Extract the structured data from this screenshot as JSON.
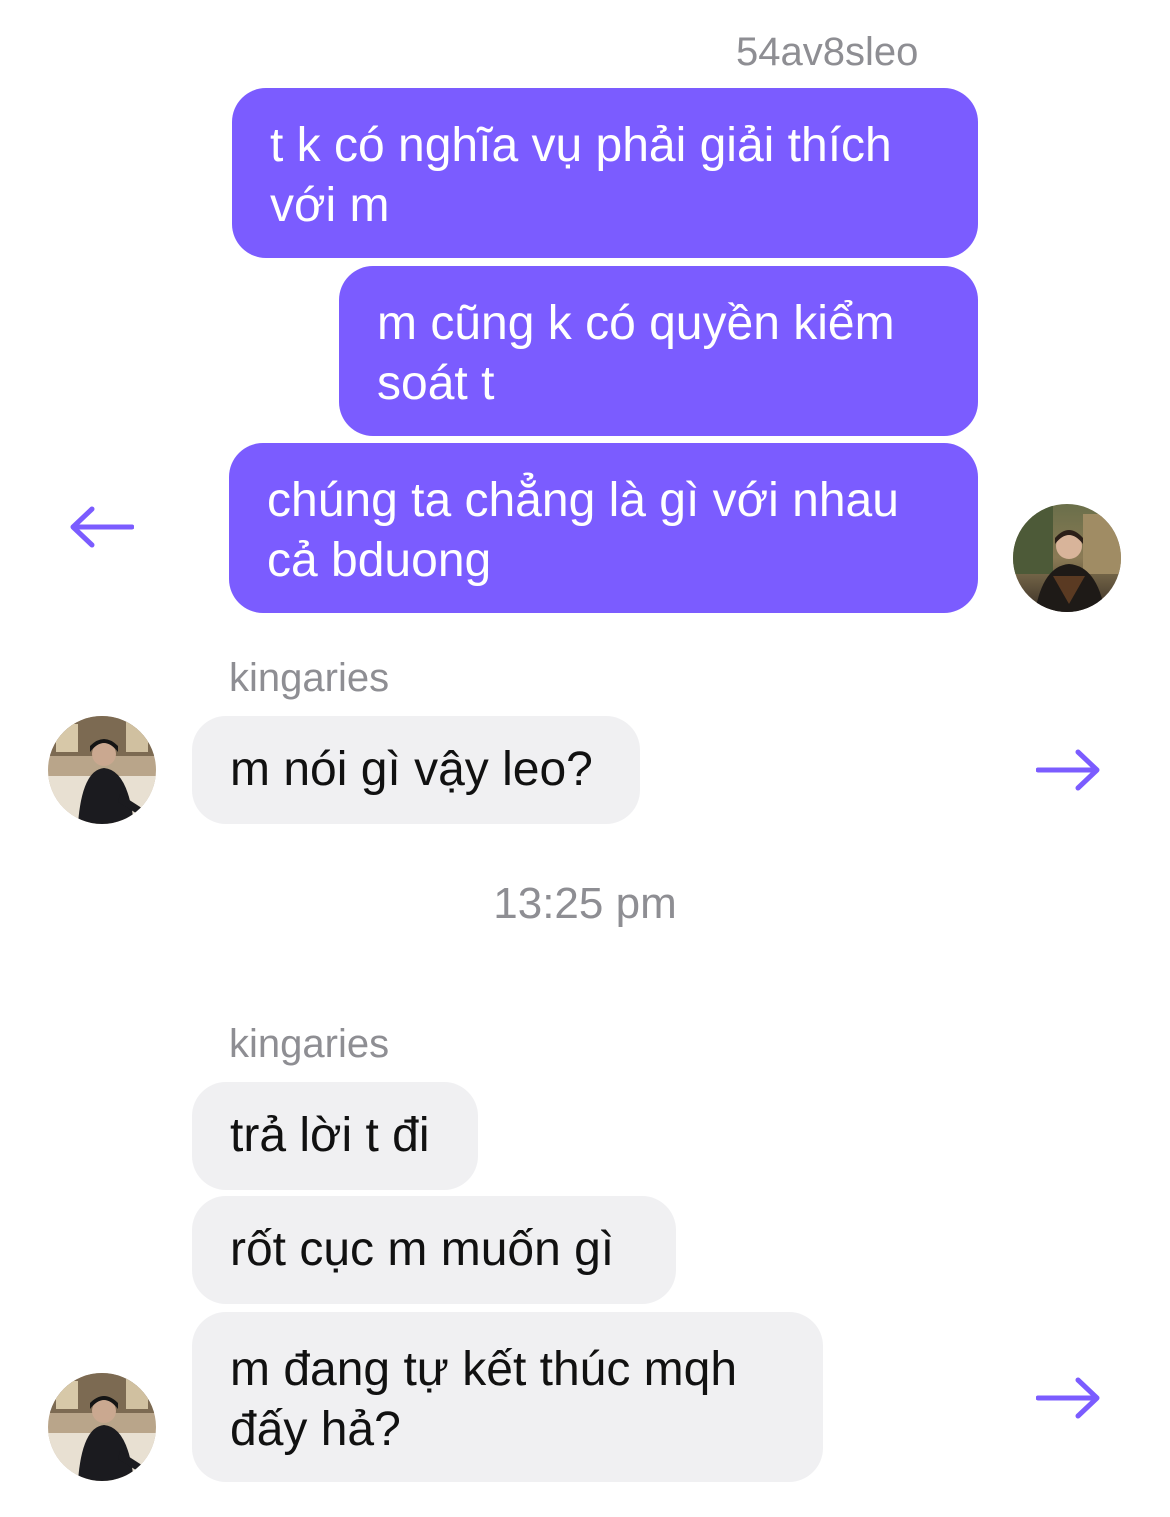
{
  "outgoing": {
    "sender": "54av8sleo",
    "messages": [
      "t k có nghĩa vụ phải giải thích với m",
      "m cũng k có quyền kiểm soát t",
      "chúng ta chẳng là gì với nhau cả bduong"
    ],
    "avatar_icon": "user-photo-avatar",
    "reply_icon": "arrow-left-icon"
  },
  "incoming_group_1": {
    "sender": "kingaries",
    "messages": [
      "m nói gì vậy leo?"
    ],
    "avatar_icon": "user-photo-avatar",
    "forward_icon": "arrow-right-icon"
  },
  "time_divider": "13:25 pm",
  "incoming_group_2": {
    "sender": "kingaries",
    "messages": [
      "trả lời t đi",
      "rốt cục m muốn gì",
      "m đang tự kết thúc mqh đấy hả?"
    ],
    "avatar_icon": "user-photo-avatar",
    "forward_icon": "arrow-right-icon"
  },
  "colors": {
    "outgoing_bubble": "#7b5cff",
    "incoming_bubble": "#f0f0f2",
    "accent_arrow": "#7b5cff",
    "meta_text": "#8e8e93"
  }
}
